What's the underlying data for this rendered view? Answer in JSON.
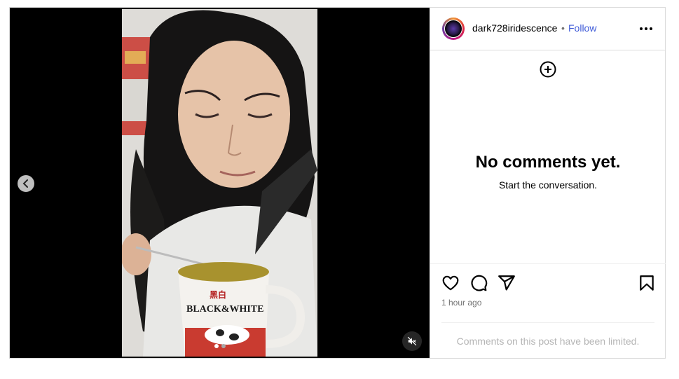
{
  "post": {
    "username": "dark728iridescence",
    "separator": "•",
    "follow_label": "Follow",
    "timestamp": "1 hour ago"
  },
  "comments": {
    "empty_title": "No comments yet.",
    "empty_subtitle": "Start the conversation.",
    "limited_notice": "Comments on this post have been limited."
  },
  "media": {
    "carousel_total": 2,
    "carousel_active_index": 0,
    "muted": true,
    "mug_brand_text": "BLACK & WHITE",
    "mug_chinese_text": "黑白"
  },
  "icons": {
    "prev": "chevron-left-icon",
    "mute": "volume-muted-icon",
    "more": "more-options-icon",
    "add": "add-comment-icon",
    "like": "heart-icon",
    "comment": "comment-icon",
    "share": "share-icon",
    "save": "bookmark-icon"
  },
  "colors": {
    "follow_link": "#3f5bd8",
    "muted_text": "#737373",
    "limited_text": "#b5b5b5",
    "border": "#dbdbdb"
  }
}
